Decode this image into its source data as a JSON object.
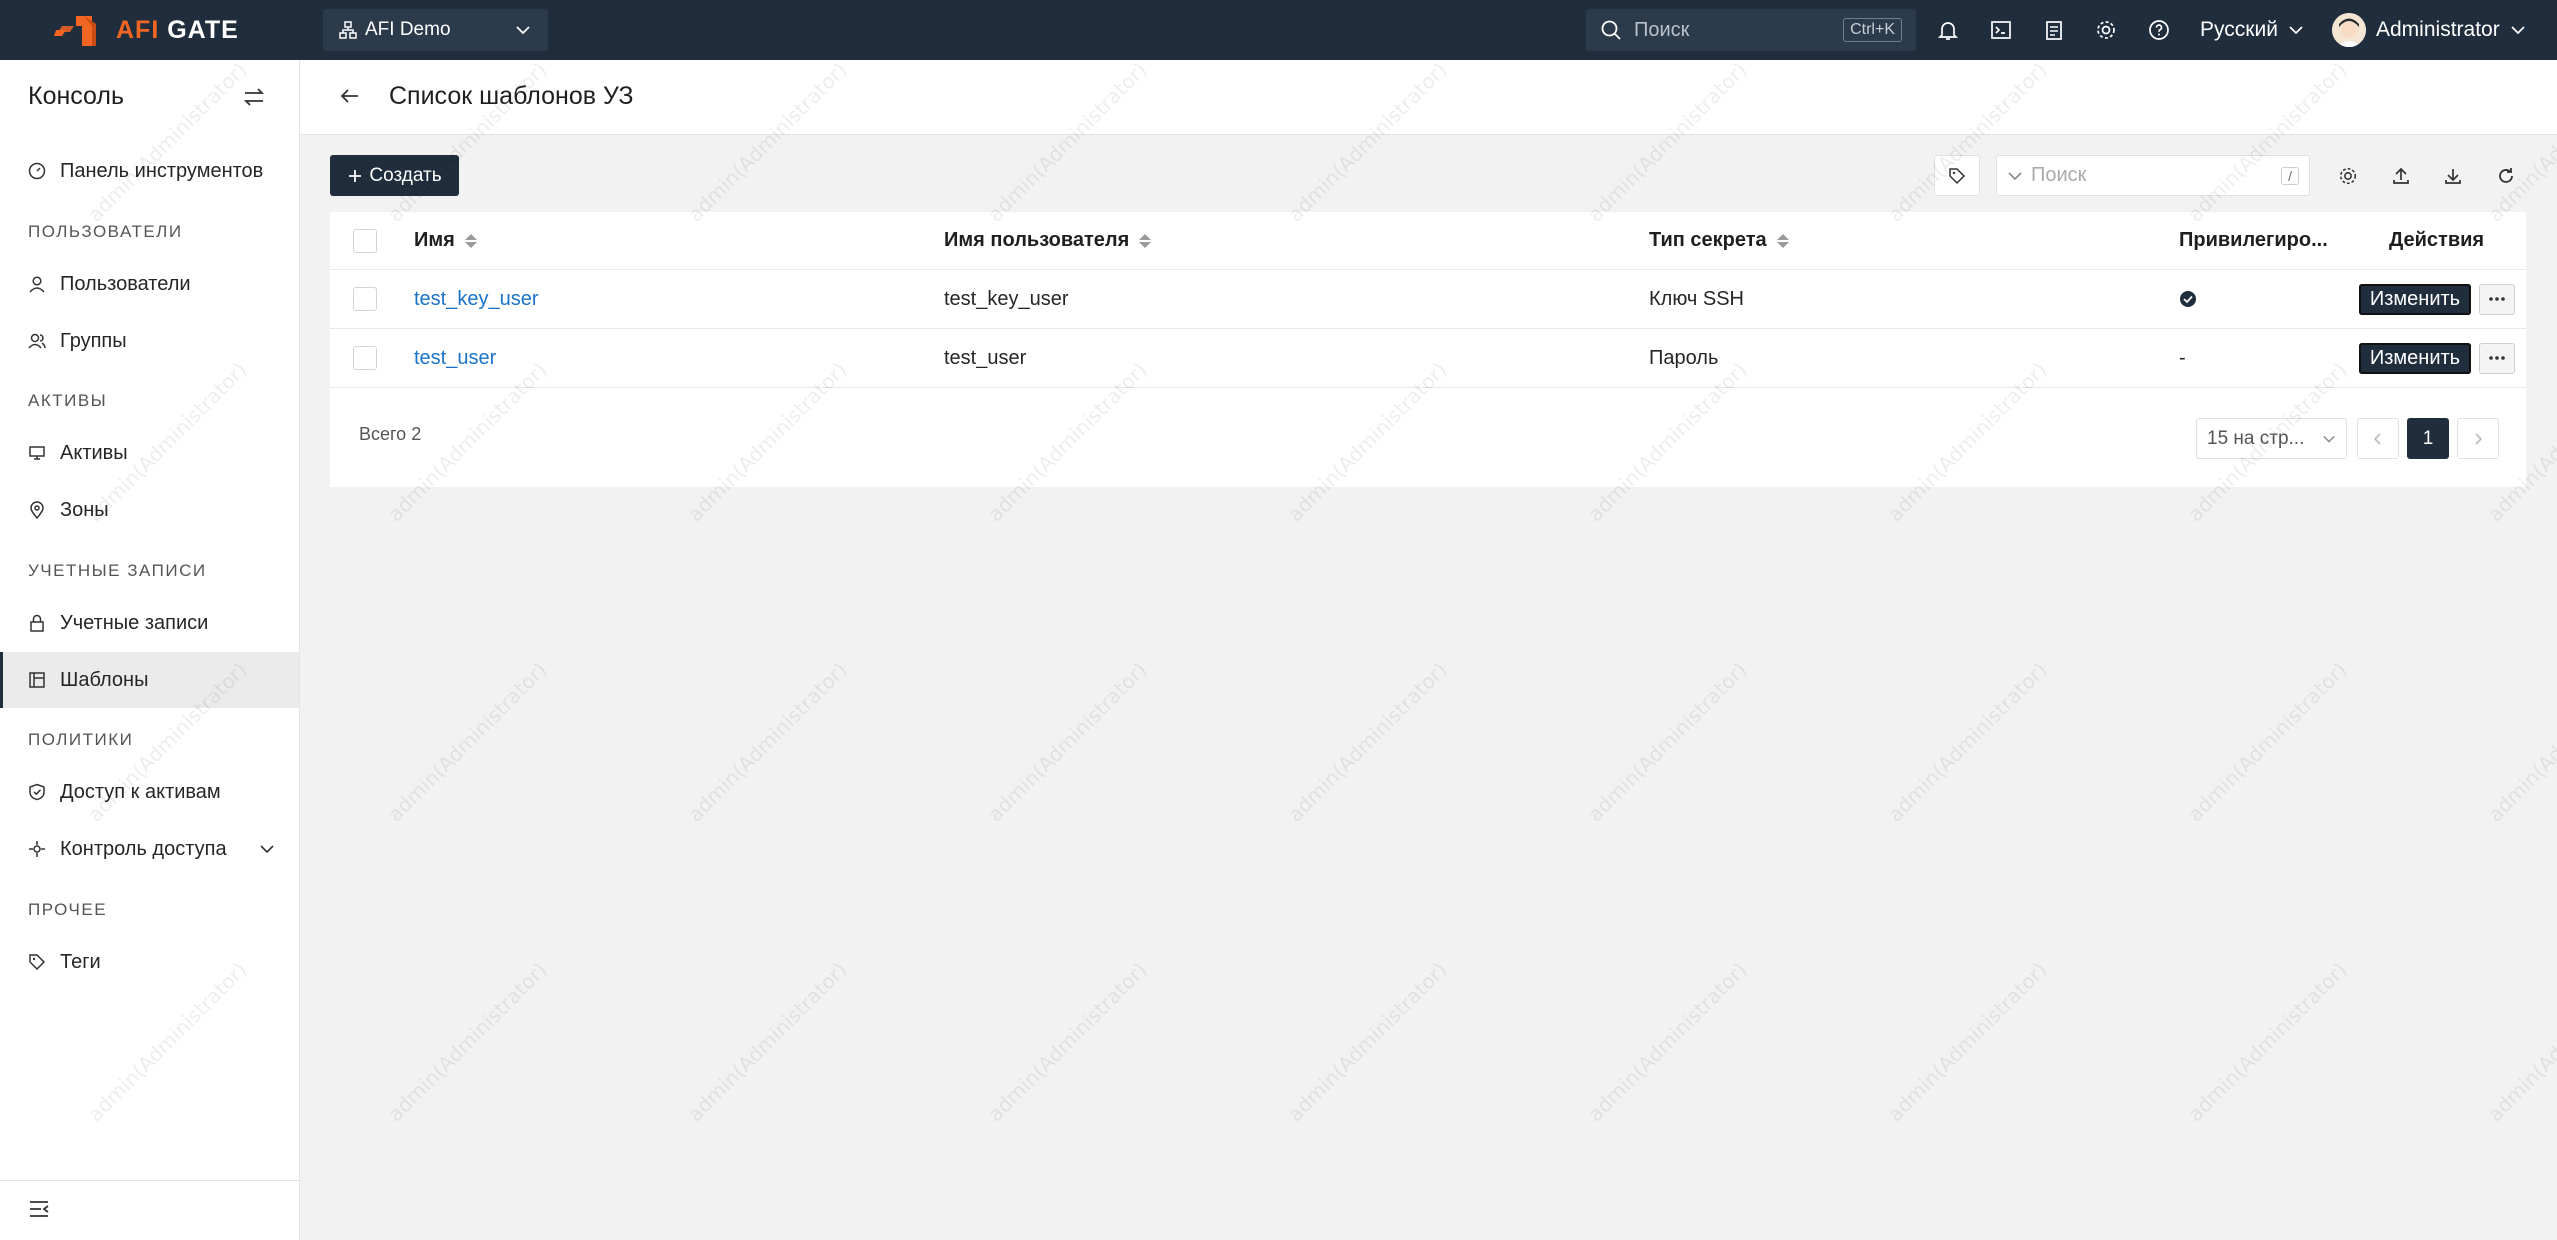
{
  "brand": {
    "prefix": "AFI",
    "suffix": " GATE"
  },
  "org_select": {
    "label": "AFI Demo"
  },
  "top_search": {
    "placeholder": "Поиск",
    "shortcut": "Ctrl+K"
  },
  "language": "Русский",
  "user": {
    "name": "Administrator"
  },
  "sidebar": {
    "title": "Консоль",
    "dashboard": "Панель инструментов",
    "sections": {
      "users": "ПОЛЬЗОВАТЕЛИ",
      "assets": "АКТИВЫ",
      "accounts": "УЧЕТНЫЕ ЗАПИСИ",
      "policies": "ПОЛИТИКИ",
      "other": "ПРОЧЕЕ"
    },
    "items": {
      "users": "Пользователи",
      "groups": "Группы",
      "assets": "Активы",
      "zones": "Зоны",
      "accounts": "Учетные записи",
      "templates": "Шаблоны",
      "asset_access": "Доступ к активам",
      "access_control": "Контроль доступа",
      "tags": "Теги"
    }
  },
  "page": {
    "title": "Список шаблонов УЗ"
  },
  "toolbar": {
    "create_label": "Создать",
    "search_placeholder": "Поиск",
    "search_shortcut": "/"
  },
  "table": {
    "columns": {
      "name": "Имя",
      "username": "Имя пользователя",
      "secret_type": "Тип секрета",
      "privileged": "Привилегиро...",
      "actions": "Действия"
    },
    "rows": [
      {
        "name": "test_key_user",
        "username": "test_key_user",
        "secret_type": "Ключ SSH",
        "privileged": "",
        "edit": "Изменить"
      },
      {
        "name": "test_user",
        "username": "test_user",
        "secret_type": "Пароль",
        "privileged": "-",
        "edit": "Изменить"
      }
    ],
    "total": "Всего 2",
    "per_page": "15 на стр...",
    "current_page": "1"
  },
  "watermark": "admin(Administrator)",
  "colors": {
    "topbar": "#1f2d3d",
    "brand_orange": "#f26522",
    "link": "#1a73c9"
  }
}
